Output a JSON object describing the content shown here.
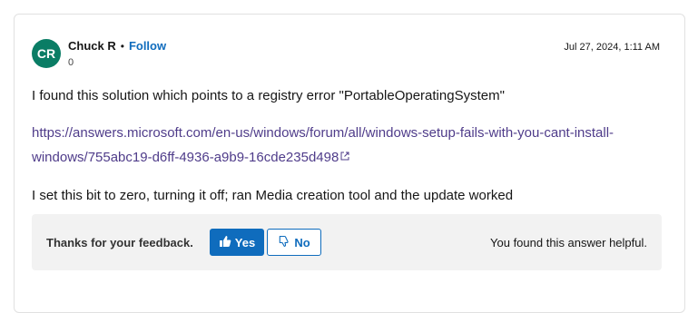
{
  "post": {
    "avatar_initials": "CR",
    "author": "Chuck R",
    "separator": "•",
    "follow_label": "Follow",
    "reputation": "0",
    "timestamp": "Jul 27, 2024, 1:11 AM",
    "paragraph1": "I found this solution which points to a registry error \"PortableOperatingSystem\"",
    "link_text": "https://answers.microsoft.com/en-us/windows/forum/all/windows-setup-fails-with-you-cant-install-windows/755abc19-d6ff-4936-a9b9-16cde235d498",
    "paragraph3": "I set this bit to zero, turning it off; ran Media creation tool and the update worked"
  },
  "feedback": {
    "label": "Thanks for your feedback.",
    "yes_label": "Yes",
    "no_label": "No",
    "status": "You found this answer helpful."
  },
  "colors": {
    "avatar_bg": "#0a7d65",
    "accent": "#0f6cbd",
    "link": "#4f3c8a",
    "feedback_bg": "#f2f2f2"
  },
  "icons": {
    "external_link": "external-link-icon",
    "thumbs_up": "thumbs-up-icon",
    "thumbs_down": "thumbs-down-icon"
  }
}
